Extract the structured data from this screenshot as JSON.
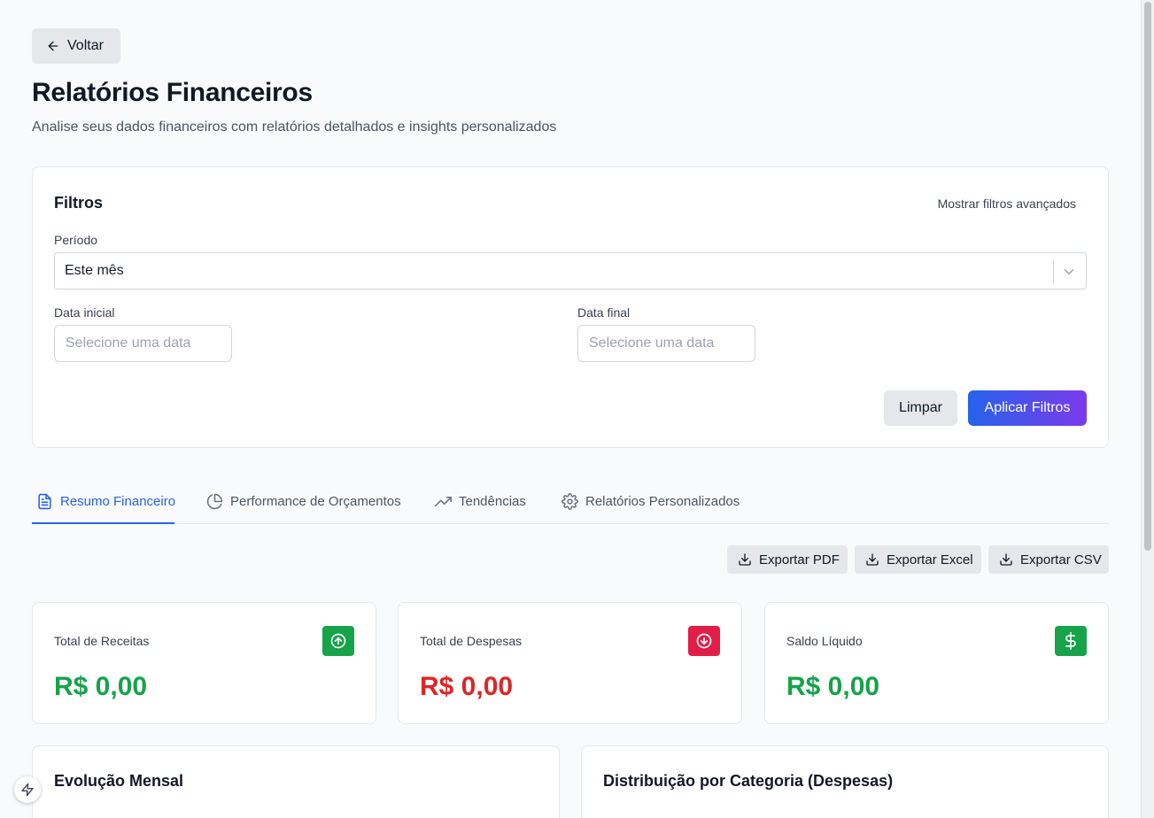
{
  "header": {
    "back_label": "Voltar",
    "title": "Relatórios Financeiros",
    "subtitle": "Analise seus dados financeiros com relatórios detalhados e insights personalizados"
  },
  "filters": {
    "title": "Filtros",
    "advanced_toggle": "Mostrar filtros avançados",
    "period_label": "Período",
    "period_value": "Este mês",
    "start_label": "Data inicial",
    "start_placeholder": "Selecione uma data",
    "end_label": "Data final",
    "end_placeholder": "Selecione uma data",
    "clear_label": "Limpar",
    "apply_label": "Aplicar Filtros"
  },
  "tabs": [
    {
      "label": "Resumo Financeiro",
      "icon": "file-text-icon",
      "active": true
    },
    {
      "label": "Performance de Orçamentos",
      "icon": "pie-chart-icon",
      "active": false
    },
    {
      "label": "Tendências",
      "icon": "trending-up-icon",
      "active": false
    },
    {
      "label": "Relatórios Personalizados",
      "icon": "gear-icon",
      "active": false
    }
  ],
  "exports": [
    {
      "label": "Exportar PDF",
      "icon": "download-icon"
    },
    {
      "label": "Exportar Excel",
      "icon": "download-icon"
    },
    {
      "label": "Exportar CSV",
      "icon": "download-icon"
    }
  ],
  "summary_cards": [
    {
      "label": "Total de Receitas",
      "value": "R$ 0,00",
      "color": "#16a34a",
      "icon": "arrow-up-circle-icon",
      "icon_bg": "#16a34a"
    },
    {
      "label": "Total de Despesas",
      "value": "R$ 0,00",
      "color": "#dc2626",
      "icon": "arrow-down-circle-icon",
      "icon_bg": "#e11d48"
    },
    {
      "label": "Saldo Líquido",
      "value": "R$ 0,00",
      "color": "#16a34a",
      "icon": "dollar-icon",
      "icon_bg": "#16a34a"
    }
  ],
  "panels": [
    {
      "title": "Evolução Mensal"
    },
    {
      "title": "Distribuição por Categoria (Despesas)"
    }
  ],
  "colors": {
    "accent": "#2563eb",
    "apply_gradient_end": "#7c3aed",
    "income": "#16a34a",
    "expense": "#dc2626"
  }
}
